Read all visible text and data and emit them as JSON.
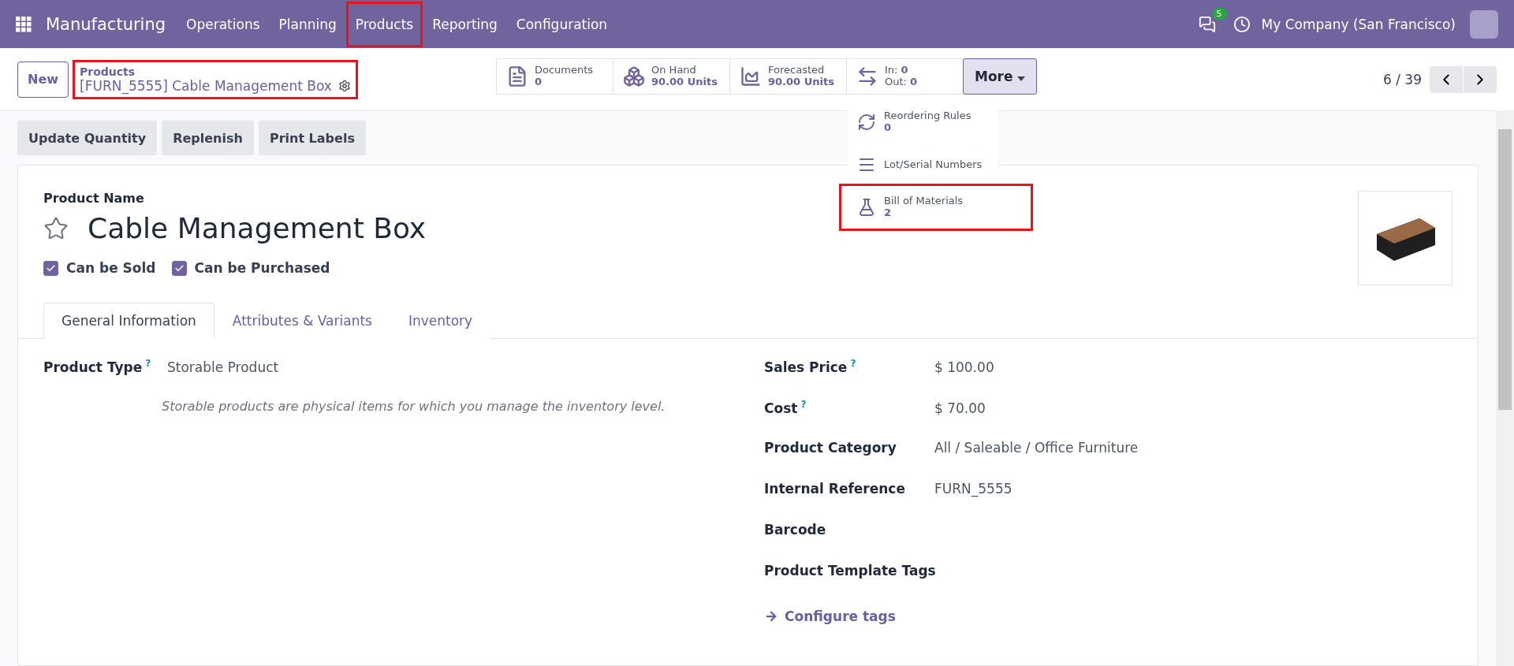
{
  "navbar": {
    "app": "Manufacturing",
    "menus": [
      {
        "label": "Operations",
        "highlighted": false
      },
      {
        "label": "Planning",
        "highlighted": false
      },
      {
        "label": "Products",
        "highlighted": true
      },
      {
        "label": "Reporting",
        "highlighted": false
      },
      {
        "label": "Configuration",
        "highlighted": false
      }
    ],
    "messages_badge": "5",
    "company": "My Company (San Francisco)"
  },
  "control_panel": {
    "new_button": "New",
    "breadcrumb": {
      "parent": "Products",
      "current": "[FURN_5555] Cable Management Box",
      "highlighted": true
    },
    "stat_buttons": [
      {
        "kind": "documents",
        "label": "Documents",
        "value": "0"
      },
      {
        "kind": "onhand",
        "label": "On Hand",
        "value": "90.00 Units"
      },
      {
        "kind": "forecast",
        "label": "Forecasted",
        "value": "90.00 Units"
      },
      {
        "kind": "inout",
        "in_label": "In:",
        "in_value": "0",
        "out_label": "Out:",
        "out_value": "0"
      }
    ],
    "more_button": "More",
    "pager": "6 / 39"
  },
  "more_menu": [
    {
      "kind": "reorder",
      "label": "Reordering Rules",
      "value": "0",
      "highlighted": false
    },
    {
      "kind": "lots",
      "label": "Lot/Serial Numbers",
      "highlighted": false
    },
    {
      "kind": "bom",
      "label": "Bill of Materials",
      "value": "2",
      "highlighted": true
    }
  ],
  "actions": [
    "Update Quantity",
    "Replenish",
    "Print Labels"
  ],
  "form": {
    "name_label": "Product Name",
    "name": "Cable Management Box",
    "favorite": false,
    "checkboxes": [
      {
        "label": "Can be Sold",
        "checked": true
      },
      {
        "label": "Can be Purchased",
        "checked": true
      }
    ],
    "tabs": [
      {
        "label": "General Information",
        "selected": true
      },
      {
        "label": "Attributes & Variants",
        "selected": false
      },
      {
        "label": "Inventory",
        "selected": false
      }
    ],
    "left_fields": [
      {
        "label": "Product Type",
        "help": "?",
        "value": "Storable Product",
        "hint": "Storable products are physical items for which you manage the inventory level."
      }
    ],
    "right_fields": [
      {
        "label": "Sales Price",
        "help": "?",
        "value": "$ 100.00"
      },
      {
        "label": "Cost",
        "help": "?",
        "value": "$ 70.00"
      },
      {
        "label": "Product Category",
        "value": "All / Saleable / Office Furniture"
      },
      {
        "label": "Internal Reference",
        "value": "FURN_5555"
      },
      {
        "label": "Barcode"
      },
      {
        "label": "Product Template Tags"
      }
    ],
    "configure_link": "Configure tags"
  }
}
